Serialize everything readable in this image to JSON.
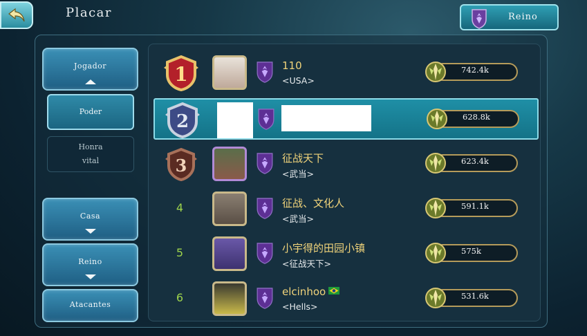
{
  "header": {
    "title": "Placar",
    "realm_button_label": "Reino"
  },
  "sidebar": {
    "jogador_label": "Jogador",
    "sub_items": [
      {
        "label": "Poder",
        "active": true
      },
      {
        "label": "Honra\nvital",
        "line1": "Honra",
        "line2": "vital",
        "active": false
      }
    ],
    "casa_label": "Casa",
    "reino_label": "Reino",
    "atacantes_label": "Atacantes"
  },
  "leaderboard": {
    "rows": [
      {
        "rank": "1",
        "name": "110",
        "guild": "<USA>",
        "power": "742.4k",
        "badge": "gold"
      },
      {
        "rank": "2",
        "name": "",
        "guild": "",
        "power": "628.8k",
        "badge": "silver",
        "redacted": true
      },
      {
        "rank": "3",
        "name": "征战天下",
        "guild": "<武当>",
        "power": "623.4k",
        "badge": "bronze"
      },
      {
        "rank": "4",
        "name": "征战、文化人",
        "guild": "<武当>",
        "power": "591.1k",
        "badge": "none"
      },
      {
        "rank": "5",
        "name": "小宇得的田园小镇",
        "guild": "<征战天下>",
        "power": "575k",
        "badge": "none"
      },
      {
        "rank": "6",
        "name": "elcinhoo",
        "guild": "<Hells>",
        "power": "531.6k",
        "badge": "none",
        "flag": "brazil-flag-icon"
      }
    ]
  },
  "colors": {
    "accent": "#1f8fa6",
    "name_gold": "#f0d37a",
    "rank_green": "#9dd34c",
    "kingdom_purple": "#6a3fa0"
  }
}
